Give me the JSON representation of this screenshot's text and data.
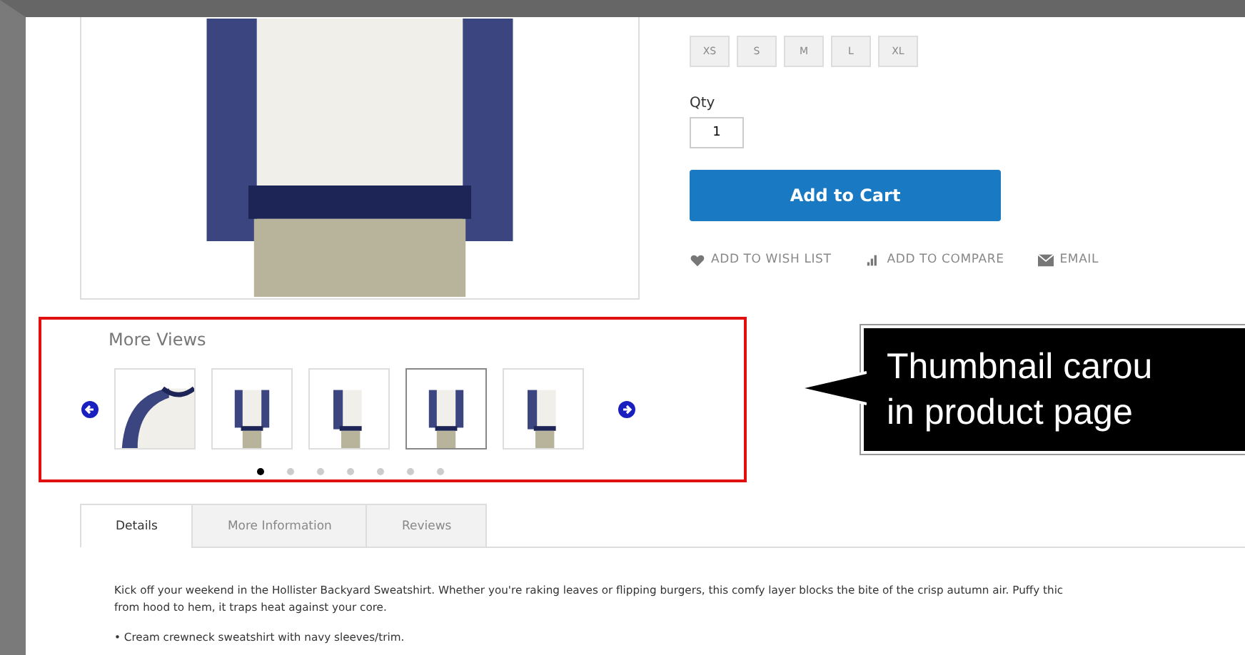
{
  "sizes": [
    {
      "label": "XS"
    },
    {
      "label": "S"
    },
    {
      "label": "M"
    },
    {
      "label": "L"
    },
    {
      "label": "XL"
    }
  ],
  "qty": {
    "label": "Qty",
    "value": "1"
  },
  "add_to_cart": "Add to Cart",
  "actions": [
    {
      "kind": "wishlist",
      "label": "ADD TO WISH LIST"
    },
    {
      "kind": "compare",
      "label": "ADD TO COMPARE"
    },
    {
      "kind": "email",
      "label": "EMAIL"
    }
  ],
  "more_views": {
    "title": "More Views",
    "thumbnails": [
      {
        "kind": "closeup",
        "selected": false
      },
      {
        "kind": "front",
        "selected": false
      },
      {
        "kind": "back",
        "selected": false
      },
      {
        "kind": "front",
        "selected": true
      },
      {
        "kind": "back",
        "selected": false
      }
    ],
    "dots": [
      {
        "selected": true
      },
      {
        "selected": false
      },
      {
        "selected": false
      },
      {
        "selected": false
      },
      {
        "selected": false
      },
      {
        "selected": false
      },
      {
        "selected": false
      }
    ]
  },
  "callout": {
    "lines": [
      "Thumbnail carou",
      "in product page"
    ]
  },
  "tabs": [
    {
      "label": "Details",
      "selected": true
    },
    {
      "label": "More Information",
      "selected": false
    },
    {
      "label": "Reviews",
      "selected": false
    }
  ],
  "description": {
    "lines": [
      "Kick off your weekend in the Hollister Backyard Sweatshirt. Whether you're raking leaves or flipping burgers, this comfy layer blocks the bite of the crisp autumn air. Puffy thic",
      "from hood to hem, it traps heat against your core."
    ],
    "bullets": [
      "• Cream crewneck sweatshirt with navy sleeves/trim."
    ]
  }
}
